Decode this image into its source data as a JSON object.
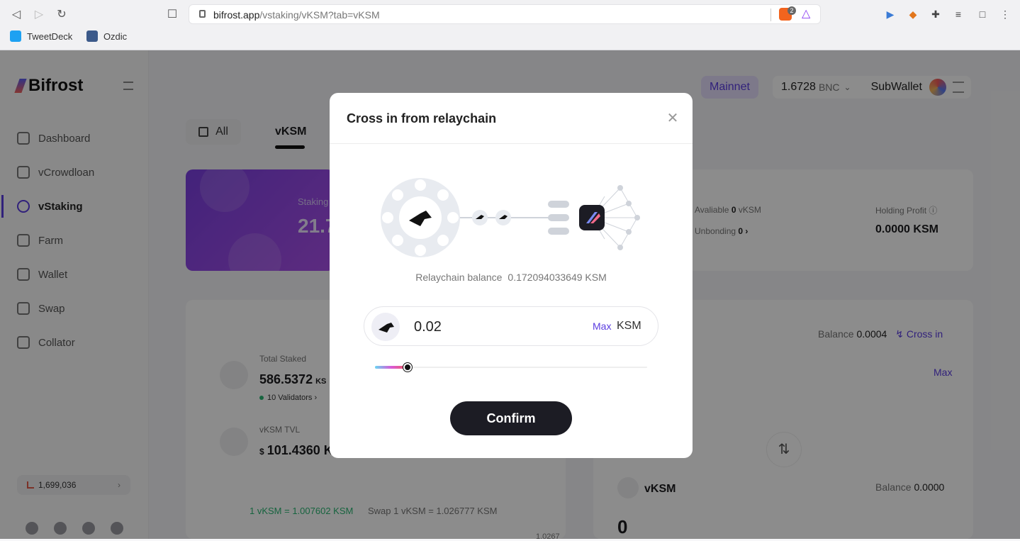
{
  "browser": {
    "url_host": "bifrost.app",
    "url_path": "/vstaking/vKSM?tab=vKSM",
    "bookmarks": [
      {
        "label": "TweetDeck",
        "icon": "twitter-icon"
      },
      {
        "label": "Ozdic",
        "icon": "ozdic-icon"
      }
    ],
    "brave_badge": "2"
  },
  "app": {
    "logo": "Bifrost",
    "nav": [
      {
        "label": "Dashboard",
        "icon": "dashboard-icon"
      },
      {
        "label": "vCrowdloan",
        "icon": "crowdloan-icon"
      },
      {
        "label": "vStaking",
        "icon": "staking-icon",
        "active": true
      },
      {
        "label": "Farm",
        "icon": "farm-icon"
      },
      {
        "label": "Wallet",
        "icon": "wallet-icon"
      },
      {
        "label": "Swap",
        "icon": "swap-icon"
      },
      {
        "label": "Collator",
        "icon": "collator-icon"
      }
    ],
    "block_height": "1,699,036",
    "network": "Mainnet",
    "bnc_balance": "1.6728",
    "bnc_unit": "BNC",
    "wallet_name": "SubWallet",
    "tabs": {
      "all": "All",
      "vksm": "vKSM"
    },
    "banner": {
      "label": "Staking",
      "value": "21.7"
    },
    "overview": {
      "available_label": "Avaliable",
      "available_value": "0",
      "available_unit": "vKSM",
      "unbonding_label": "Unbonding",
      "unbonding_value": "0 ›",
      "holding_profit_label": "Holding Profit",
      "holding_profit_value": "0.0000 KSM"
    },
    "stats": {
      "total_staked_label": "Total Staked",
      "total_staked_value": "586.5372",
      "total_staked_unit": "KS",
      "validators": "10 Validators ›",
      "tvl_label": "vKSM TVL",
      "tvl_currency": "$",
      "tvl_value": "101.4360 K",
      "rate": "1 vKSM = 1.007602 KSM",
      "swap_rate": "Swap 1 vKSM = 1.026777 KSM",
      "partial_number": "1.0267"
    },
    "swap_panel": {
      "balance_label": "Balance",
      "balance_value": "0.0004",
      "cross_in": "Cross in",
      "max": "Max",
      "token": "vKSM",
      "to_balance_label": "Balance",
      "to_balance_value": "0.0000",
      "amount": "0"
    }
  },
  "modal": {
    "title": "Cross in from relaychain",
    "balance_label": "Relaychain balance",
    "balance_value": "0.172094033649 KSM",
    "amount_value": "0.02",
    "max_label": "Max",
    "unit": "KSM",
    "slider_fraction": 0.12,
    "confirm_label": "Confirm"
  }
}
